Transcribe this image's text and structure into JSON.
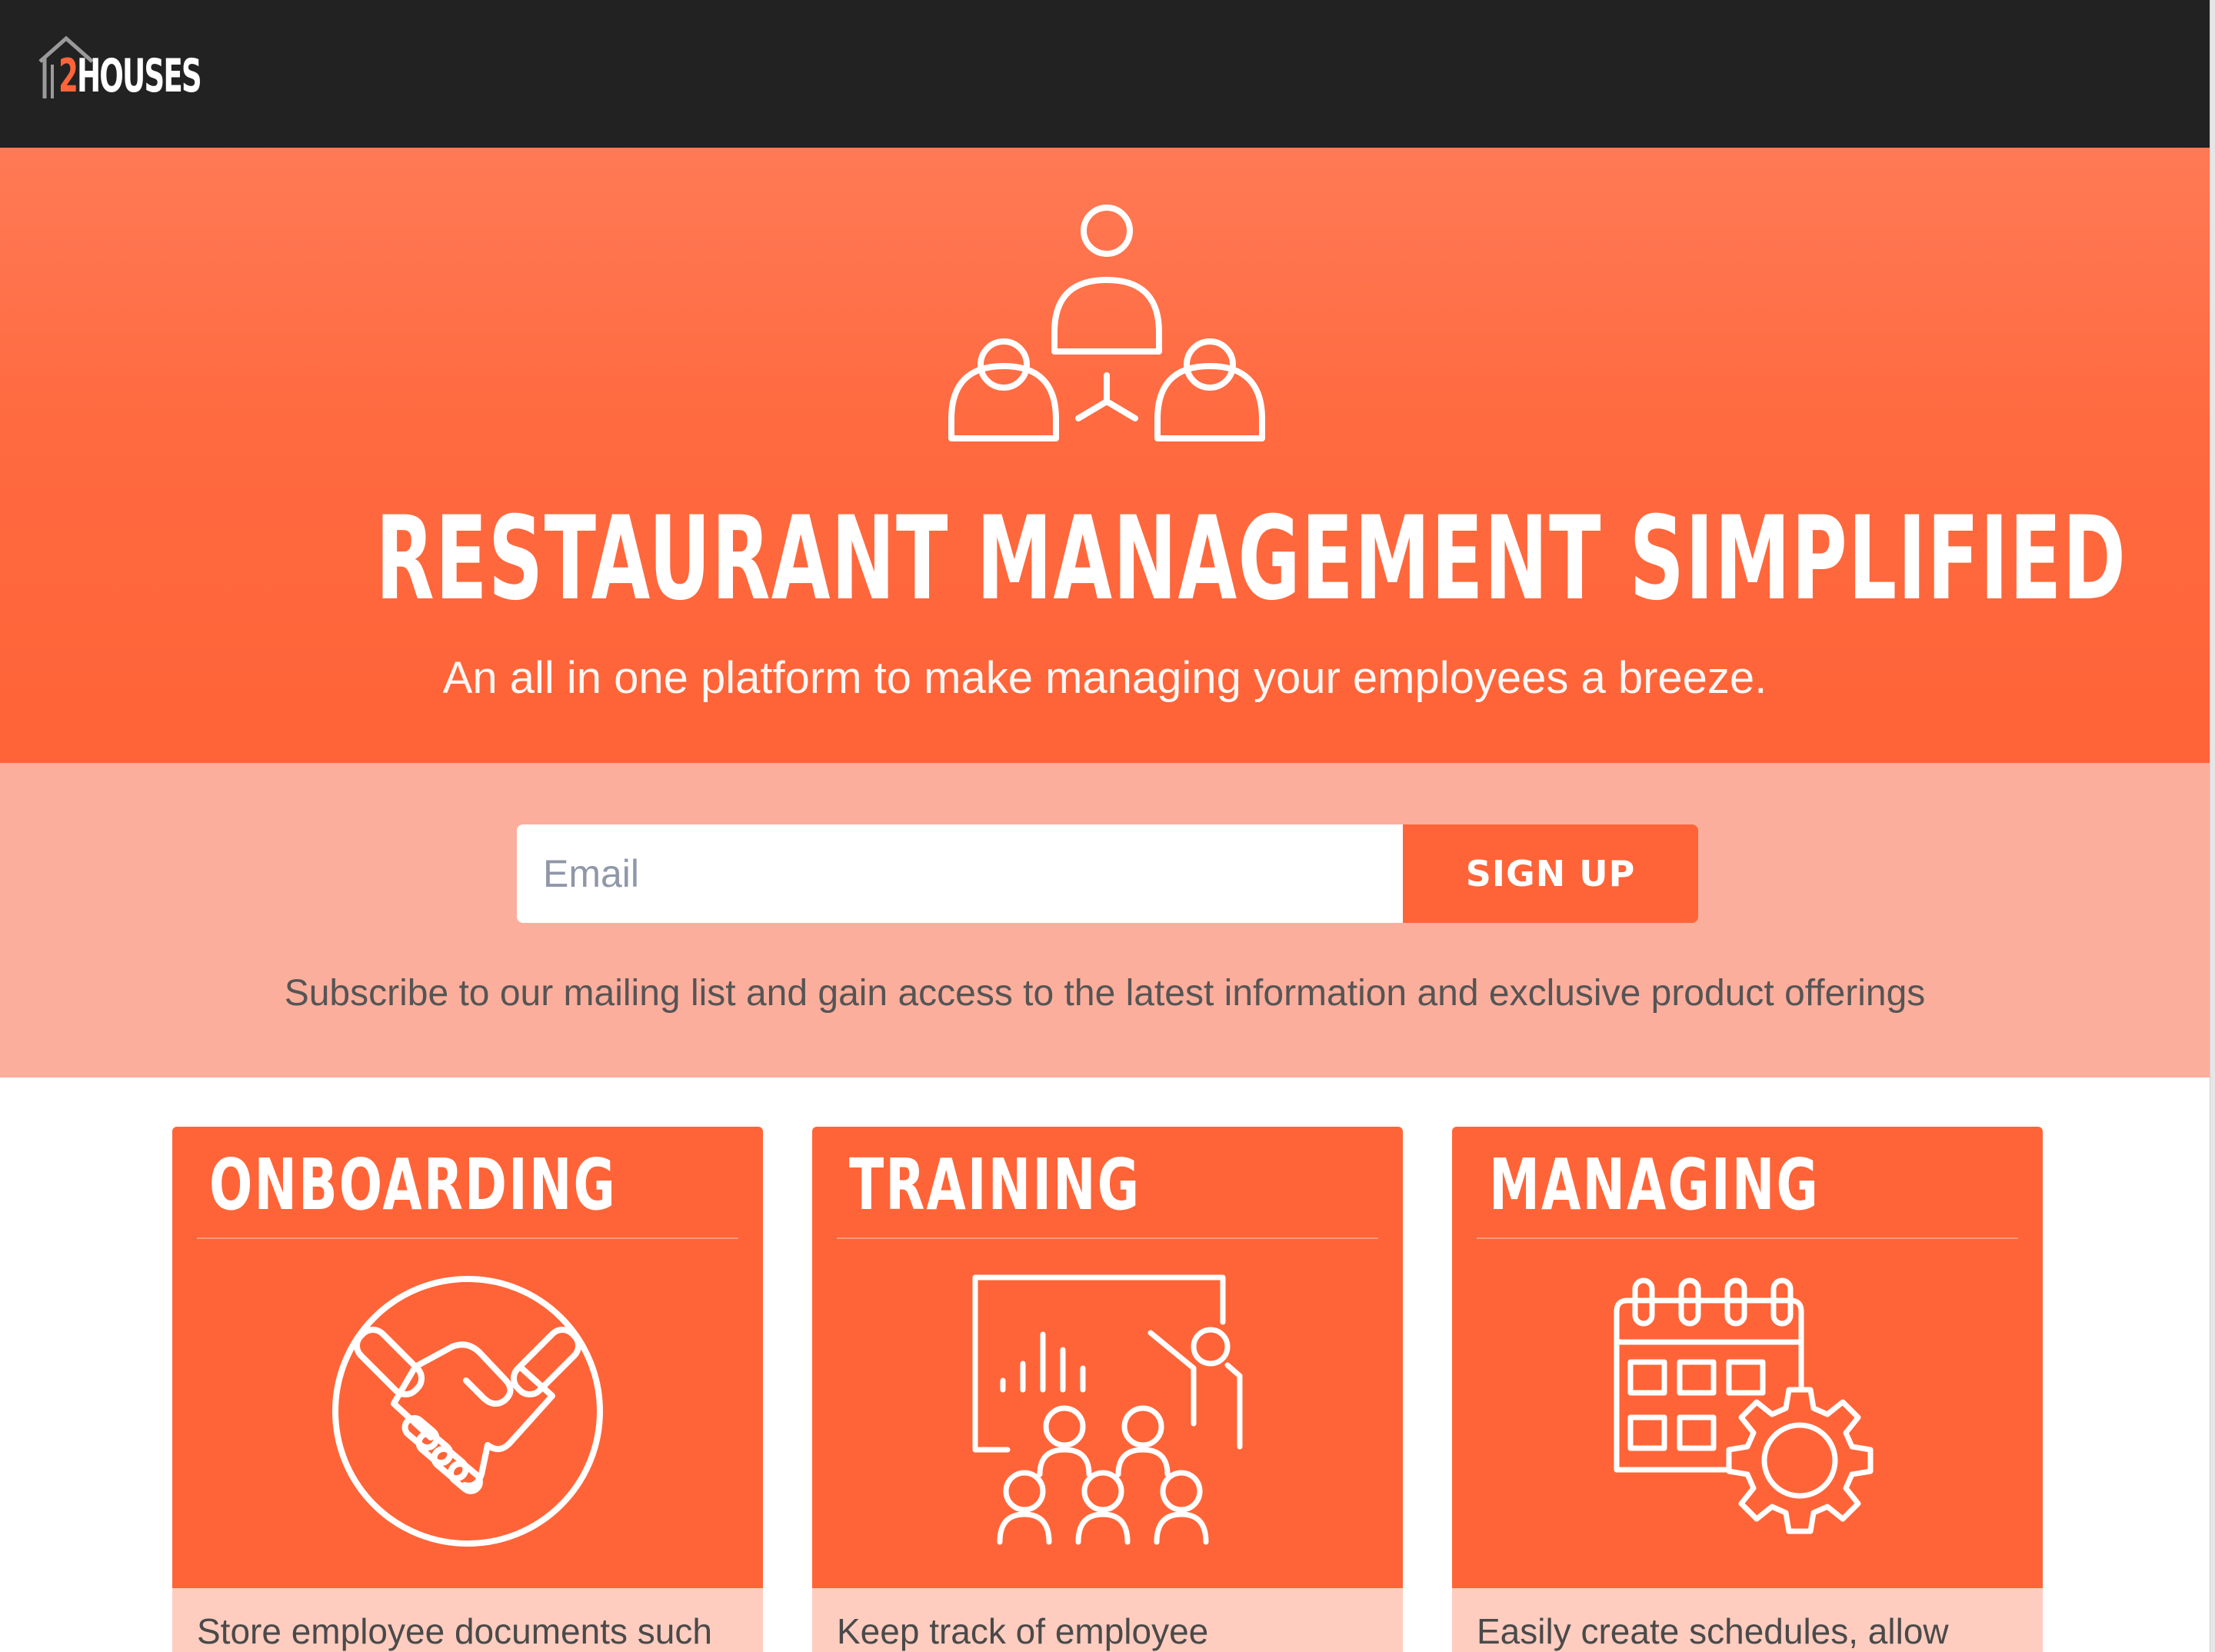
{
  "brand": {
    "logo_two": "2",
    "logo_rest": "HOUSES"
  },
  "colors": {
    "accent": "#ff6438",
    "navbar": "#222222",
    "signup_band": "#fcae9c",
    "card_body": "#ffcdbf"
  },
  "hero": {
    "icon": "team-network-icon",
    "title": "RESTAURANT MANAGEMENT SIMPLIFIED",
    "subtitle": "An all in one platform to make managing your employees a breeze."
  },
  "signup": {
    "email_placeholder": "Email",
    "button_label": "SIGN UP",
    "note": "Subscribe to our mailing list and gain access to the latest information and exclusive product offerings"
  },
  "features": [
    {
      "title": "ONBOARDING",
      "icon": "handshake-icon",
      "description": "Store employee documents such"
    },
    {
      "title": "TRAINING",
      "icon": "presentation-icon",
      "description": "Keep track of employee"
    },
    {
      "title": "MANAGING",
      "icon": "calendar-gear-icon",
      "description": "Easily create schedules, allow"
    }
  ]
}
